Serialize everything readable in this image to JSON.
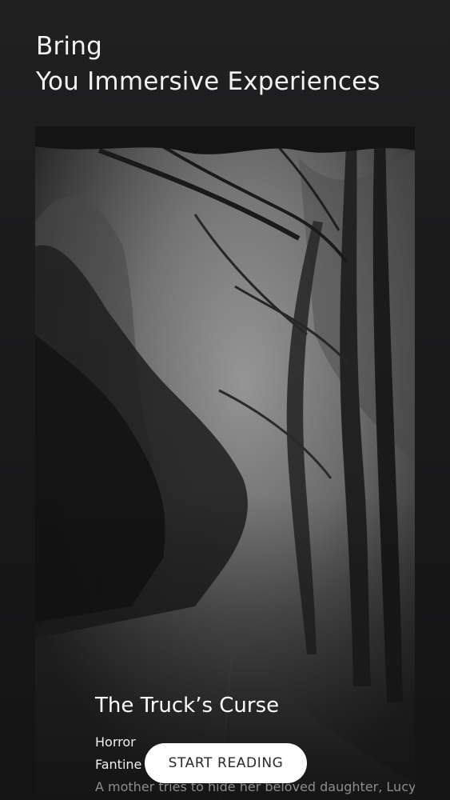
{
  "header": {
    "line1": "Bring",
    "line2": "You Immersive Experiences"
  },
  "story": {
    "cover_image": "foggy-forest-road-image",
    "title": "The Truck’s Curse",
    "genre": "Horror",
    "author": "Fantine Dream",
    "description": "A mother tries to hide her beloved daughter, Lucy, from the evil murderer, Lucy’s uncle. But she realizes something is going wrong……"
  },
  "actions": {
    "start_label": "START READING"
  },
  "colors": {
    "background": "#1b1b1c",
    "button": "#ffffff",
    "button_text": "#2a2a2a",
    "description_text": "#8d8d8d"
  }
}
